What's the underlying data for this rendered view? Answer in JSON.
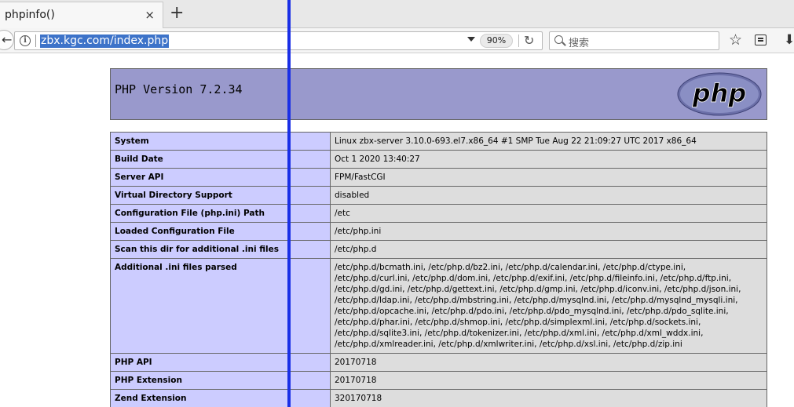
{
  "browser": {
    "tab": {
      "title": "phpinfo()",
      "close_label": "×"
    },
    "new_tab_label": "+",
    "url": "zbx.kgc.com/index.php",
    "zoom": "90%",
    "search_placeholder": "搜索"
  },
  "page": {
    "header_title": "PHP Version 7.2.34",
    "logo_text": "php",
    "rows": [
      {
        "key": "System",
        "value": "Linux zbx-server 3.10.0-693.el7.x86_64 #1 SMP Tue Aug 22 21:09:27 UTC 2017 x86_64"
      },
      {
        "key": "Build Date",
        "value": "Oct 1 2020 13:40:27"
      },
      {
        "key": "Server API",
        "value": "FPM/FastCGI"
      },
      {
        "key": "Virtual Directory Support",
        "value": "disabled"
      },
      {
        "key": "Configuration File (php.ini) Path",
        "value": "/etc"
      },
      {
        "key": "Loaded Configuration File",
        "value": "/etc/php.ini"
      },
      {
        "key": "Scan this dir for additional .ini files",
        "value": "/etc/php.d"
      },
      {
        "key": "Additional .ini files parsed",
        "value": "/etc/php.d/bcmath.ini, /etc/php.d/bz2.ini, /etc/php.d/calendar.ini, /etc/php.d/ctype.ini, /etc/php.d/curl.ini, /etc/php.d/dom.ini, /etc/php.d/exif.ini, /etc/php.d/fileinfo.ini, /etc/php.d/ftp.ini, /etc/php.d/gd.ini, /etc/php.d/gettext.ini, /etc/php.d/gmp.ini, /etc/php.d/iconv.ini, /etc/php.d/json.ini, /etc/php.d/ldap.ini, /etc/php.d/mbstring.ini, /etc/php.d/mysqlnd.ini, /etc/php.d/mysqlnd_mysqli.ini, /etc/php.d/opcache.ini, /etc/php.d/pdo.ini, /etc/php.d/pdo_mysqlnd.ini, /etc/php.d/pdo_sqlite.ini, /etc/php.d/phar.ini, /etc/php.d/shmop.ini, /etc/php.d/simplexml.ini, /etc/php.d/sockets.ini, /etc/php.d/sqlite3.ini, /etc/php.d/tokenizer.ini, /etc/php.d/xml.ini, /etc/php.d/xml_wddx.ini, /etc/php.d/xmlreader.ini, /etc/php.d/xmlwriter.ini, /etc/php.d/xsl.ini, /etc/php.d/zip.ini"
      },
      {
        "key": "PHP API",
        "value": "20170718"
      },
      {
        "key": "PHP Extension",
        "value": "20170718"
      },
      {
        "key": "Zend Extension",
        "value": "320170718"
      }
    ]
  },
  "colors": {
    "header_bg": "#9999cc",
    "key_cell_bg": "#ccccff",
    "value_cell_bg": "#dddddd",
    "url_selection": "#3d73c9",
    "overlay_line": "#1a2fe6"
  }
}
